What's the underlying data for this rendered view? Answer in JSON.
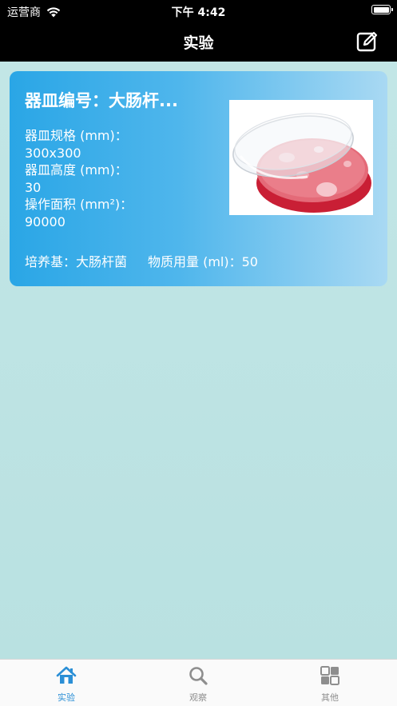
{
  "status_bar": {
    "carrier": "运营商",
    "time": "下午 4:42"
  },
  "nav": {
    "title": "实验"
  },
  "card": {
    "title": "器皿编号：大肠杆...",
    "spec_label": "器皿规格 (mm)：",
    "spec_value": "300x300",
    "height_label": "器皿高度 (mm)：",
    "height_value": "30",
    "area_label": "操作面积 (mm²)：",
    "area_value": "90000",
    "medium": "培养基：大肠杆菌",
    "amount": "物质用量 (ml)：50"
  },
  "tabs": [
    {
      "label": "实验",
      "icon": "home-icon",
      "active": true
    },
    {
      "label": "观察",
      "icon": "search-icon",
      "active": false
    },
    {
      "label": "其他",
      "icon": "grid-icon",
      "active": false
    }
  ],
  "colors": {
    "accent": "#2b8fd6",
    "card_start": "#2aa6e6",
    "card_end": "#a9d9f3",
    "background": "#bde3e3"
  }
}
